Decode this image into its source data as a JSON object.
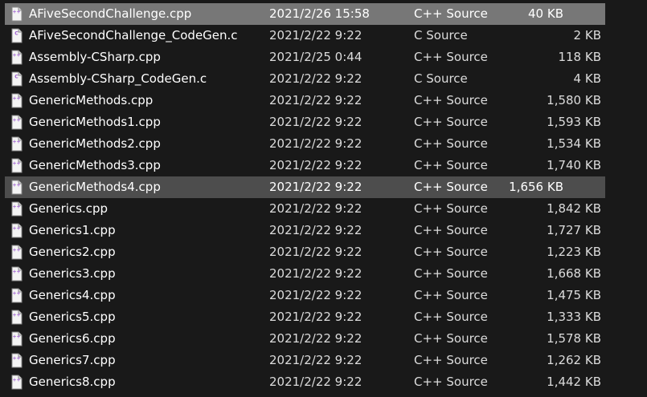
{
  "files": [
    {
      "name": "AFiveSecondChallenge.cpp",
      "date": "2021/2/26 15:58",
      "type": "C++ Source",
      "size": "40 KB",
      "icon": "cpp-file-icon",
      "state": "selected"
    },
    {
      "name": "AFiveSecondChallenge_CodeGen.c",
      "date": "2021/2/22 9:22",
      "type": "C Source",
      "size": "2 KB",
      "icon": "c-file-icon",
      "state": ""
    },
    {
      "name": "Assembly-CSharp.cpp",
      "date": "2021/2/25 0:44",
      "type": "C++ Source",
      "size": "118 KB",
      "icon": "cpp-file-icon",
      "state": ""
    },
    {
      "name": "Assembly-CSharp_CodeGen.c",
      "date": "2021/2/22 9:22",
      "type": "C Source",
      "size": "4 KB",
      "icon": "c-file-icon",
      "state": ""
    },
    {
      "name": "GenericMethods.cpp",
      "date": "2021/2/22 9:22",
      "type": "C++ Source",
      "size": "1,580 KB",
      "icon": "cpp-file-icon",
      "state": ""
    },
    {
      "name": "GenericMethods1.cpp",
      "date": "2021/2/22 9:22",
      "type": "C++ Source",
      "size": "1,593 KB",
      "icon": "cpp-file-icon",
      "state": ""
    },
    {
      "name": "GenericMethods2.cpp",
      "date": "2021/2/22 9:22",
      "type": "C++ Source",
      "size": "1,534 KB",
      "icon": "cpp-file-icon",
      "state": ""
    },
    {
      "name": "GenericMethods3.cpp",
      "date": "2021/2/22 9:22",
      "type": "C++ Source",
      "size": "1,740 KB",
      "icon": "cpp-file-icon",
      "state": ""
    },
    {
      "name": "GenericMethods4.cpp",
      "date": "2021/2/22 9:22",
      "type": "C++ Source",
      "size": "1,656 KB",
      "icon": "cpp-file-icon",
      "state": "hovered"
    },
    {
      "name": "Generics.cpp",
      "date": "2021/2/22 9:22",
      "type": "C++ Source",
      "size": "1,842 KB",
      "icon": "cpp-file-icon",
      "state": ""
    },
    {
      "name": "Generics1.cpp",
      "date": "2021/2/22 9:22",
      "type": "C++ Source",
      "size": "1,727 KB",
      "icon": "cpp-file-icon",
      "state": ""
    },
    {
      "name": "Generics2.cpp",
      "date": "2021/2/22 9:22",
      "type": "C++ Source",
      "size": "1,223 KB",
      "icon": "cpp-file-icon",
      "state": ""
    },
    {
      "name": "Generics3.cpp",
      "date": "2021/2/22 9:22",
      "type": "C++ Source",
      "size": "1,668 KB",
      "icon": "cpp-file-icon",
      "state": ""
    },
    {
      "name": "Generics4.cpp",
      "date": "2021/2/22 9:22",
      "type": "C++ Source",
      "size": "1,475 KB",
      "icon": "cpp-file-icon",
      "state": ""
    },
    {
      "name": "Generics5.cpp",
      "date": "2021/2/22 9:22",
      "type": "C++ Source",
      "size": "1,333 KB",
      "icon": "cpp-file-icon",
      "state": ""
    },
    {
      "name": "Generics6.cpp",
      "date": "2021/2/22 9:22",
      "type": "C++ Source",
      "size": "1,578 KB",
      "icon": "cpp-file-icon",
      "state": ""
    },
    {
      "name": "Generics7.cpp",
      "date": "2021/2/22 9:22",
      "type": "C++ Source",
      "size": "1,262 KB",
      "icon": "cpp-file-icon",
      "state": ""
    },
    {
      "name": "Generics8.cpp",
      "date": "2021/2/22 9:22",
      "type": "C++ Source",
      "size": "1,442 KB",
      "icon": "cpp-file-icon",
      "state": ""
    }
  ],
  "icon_labels": {
    "cpp": "++",
    "c": "C"
  },
  "colors": {
    "background": "#191919",
    "selected_row": "#777777",
    "hovered_row": "#4d4d4d",
    "text": "#ffffff",
    "secondary_text": "#dcdcdc",
    "icon_accent": "#9b59d0"
  }
}
